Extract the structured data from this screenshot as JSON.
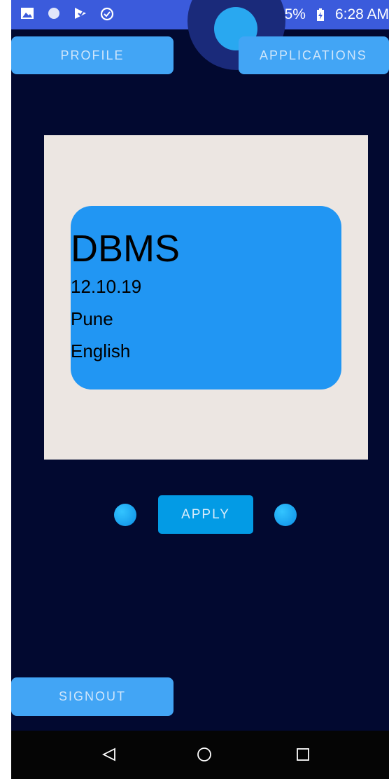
{
  "status_bar": {
    "battery": "65%",
    "time": "6:28 AM",
    "left_icons": [
      "image-icon",
      "circle-icon",
      "play-check-icon",
      "clock-check-icon"
    ],
    "right_icons": [
      "hotspot-icon",
      "vibrate-icon",
      "signal-4g-icon",
      "battery-charging-icon"
    ]
  },
  "header": {
    "profile_label": "PROFILE",
    "applications_label": "APPLICATIONS"
  },
  "card": {
    "title": "DBMS",
    "date": "12.10.19",
    "location": "Pune",
    "language": "English"
  },
  "actions": {
    "apply_label": "APPLY"
  },
  "footer": {
    "signout_label": "SIGNOUT"
  },
  "navigation": {
    "icons": [
      "back-icon",
      "home-icon",
      "recents-icon"
    ]
  },
  "colors": {
    "background": "#020930",
    "button": "#42a5f5",
    "card_outer": "#ece6e2",
    "card_inner": "#2196f3",
    "apply": "#039be5",
    "status_bar": "#3b5bdc"
  }
}
